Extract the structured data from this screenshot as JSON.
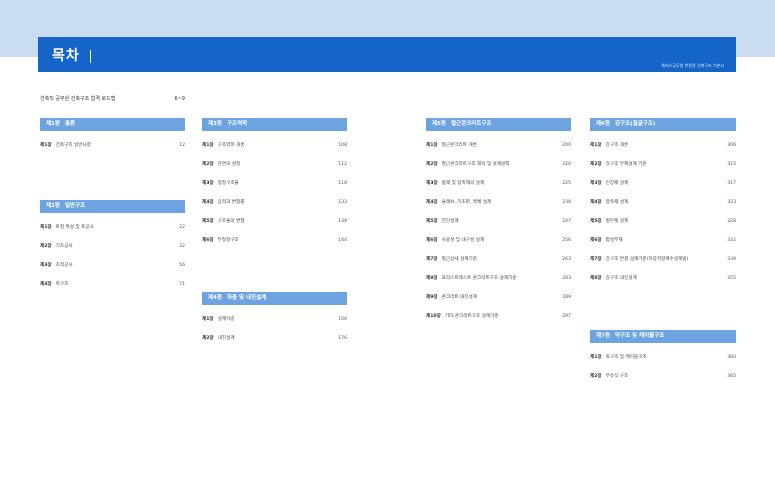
{
  "header": {
    "title": "목차",
    "book_title": "해커스공무원 반원관 건축구조 기본서"
  },
  "roadmap": {
    "label": "건축직 공무원 건축구조 합격 로드맵",
    "page": "6~9"
  },
  "parts": [
    {
      "no": "제1편",
      "title": "총론",
      "chapters": [
        {
          "no": "제1장",
          "title": "건축구조 일반사항",
          "page": "12"
        }
      ]
    },
    {
      "no": "제2편",
      "title": "일반구조",
      "chapters": [
        {
          "no": "제1장",
          "title": "토질 특성 및 토공사",
          "page": "22"
        },
        {
          "no": "제2장",
          "title": "기초공사",
          "page": "32"
        },
        {
          "no": "제3장",
          "title": "조적공사",
          "page": "56"
        },
        {
          "no": "제4장",
          "title": "목구조",
          "page": "71"
        }
      ]
    },
    {
      "no": "제3편",
      "title": "구조역학",
      "chapters": [
        {
          "no": "제1장",
          "title": "구조역학 개론",
          "page": "108"
        },
        {
          "no": "제2장",
          "title": "단면의 성질",
          "page": "112"
        },
        {
          "no": "제3장",
          "title": "정정구조물",
          "page": "118"
        },
        {
          "no": "제4장",
          "title": "응력과 변형률",
          "page": "133"
        },
        {
          "no": "제5장",
          "title": "구조물의 변형",
          "page": "139"
        },
        {
          "no": "제6장",
          "title": "부정정구조",
          "page": "144"
        }
      ]
    },
    {
      "no": "제4편",
      "title": "하중 및 내진설계",
      "chapters": [
        {
          "no": "제1장",
          "title": "설계하중",
          "page": "150"
        },
        {
          "no": "제2장",
          "title": "내진설계",
          "page": "176"
        }
      ]
    },
    {
      "no": "제5편",
      "title": "철근콘크리트구조",
      "chapters": [
        {
          "no": "제1장",
          "title": "철근콘크리트 개론",
          "page": "200"
        },
        {
          "no": "제2장",
          "title": "철근콘크리트구조 해석 및 설계원칙",
          "page": "220"
        },
        {
          "no": "제3장",
          "title": "휨재 및 압축재의 설계",
          "page": "225"
        },
        {
          "no": "제4장",
          "title": "슬래브, 기초판, 벽체 설계",
          "page": "238"
        },
        {
          "no": "제5장",
          "title": "전단설계",
          "page": "247"
        },
        {
          "no": "제6장",
          "title": "사용성 및 내구성 설계",
          "page": "256"
        },
        {
          "no": "제7장",
          "title": "철근상세 설계기준",
          "page": "263"
        },
        {
          "no": "제8장",
          "title": "프리스트레스트 콘크리트구조 설계기준",
          "page": "283"
        },
        {
          "no": "제9장",
          "title": "콘크리트 내진설계",
          "page": "289"
        },
        {
          "no": "제10장",
          "title": "기타 콘크리트구조 설계기준",
          "page": "297"
        }
      ]
    },
    {
      "no": "제6편",
      "title": "강구조(철골구조)",
      "chapters": [
        {
          "no": "제1장",
          "title": "강구조 개론",
          "page": "306"
        },
        {
          "no": "제2장",
          "title": "강구조 부재설계 기준",
          "page": "315"
        },
        {
          "no": "제3장",
          "title": "인장재 설계",
          "page": "317"
        },
        {
          "no": "제4장",
          "title": "압축재 설계",
          "page": "323"
        },
        {
          "no": "제5장",
          "title": "휨부재 설계",
          "page": "328"
        },
        {
          "no": "제6장",
          "title": "합성부재",
          "page": "332"
        },
        {
          "no": "제7장",
          "title": "강구조 연결 설계기준(하중저항계수설계법)",
          "page": "339"
        },
        {
          "no": "제8장",
          "title": "강구조 내진설계",
          "page": "355"
        }
      ]
    },
    {
      "no": "제7편",
      "title": "막구조 및 케이블구조",
      "chapters": [
        {
          "no": "제1장",
          "title": "막구조 및 케이블구조",
          "page": "360"
        },
        {
          "no": "제2장",
          "title": "부유식 구조",
          "page": "365"
        }
      ]
    }
  ]
}
